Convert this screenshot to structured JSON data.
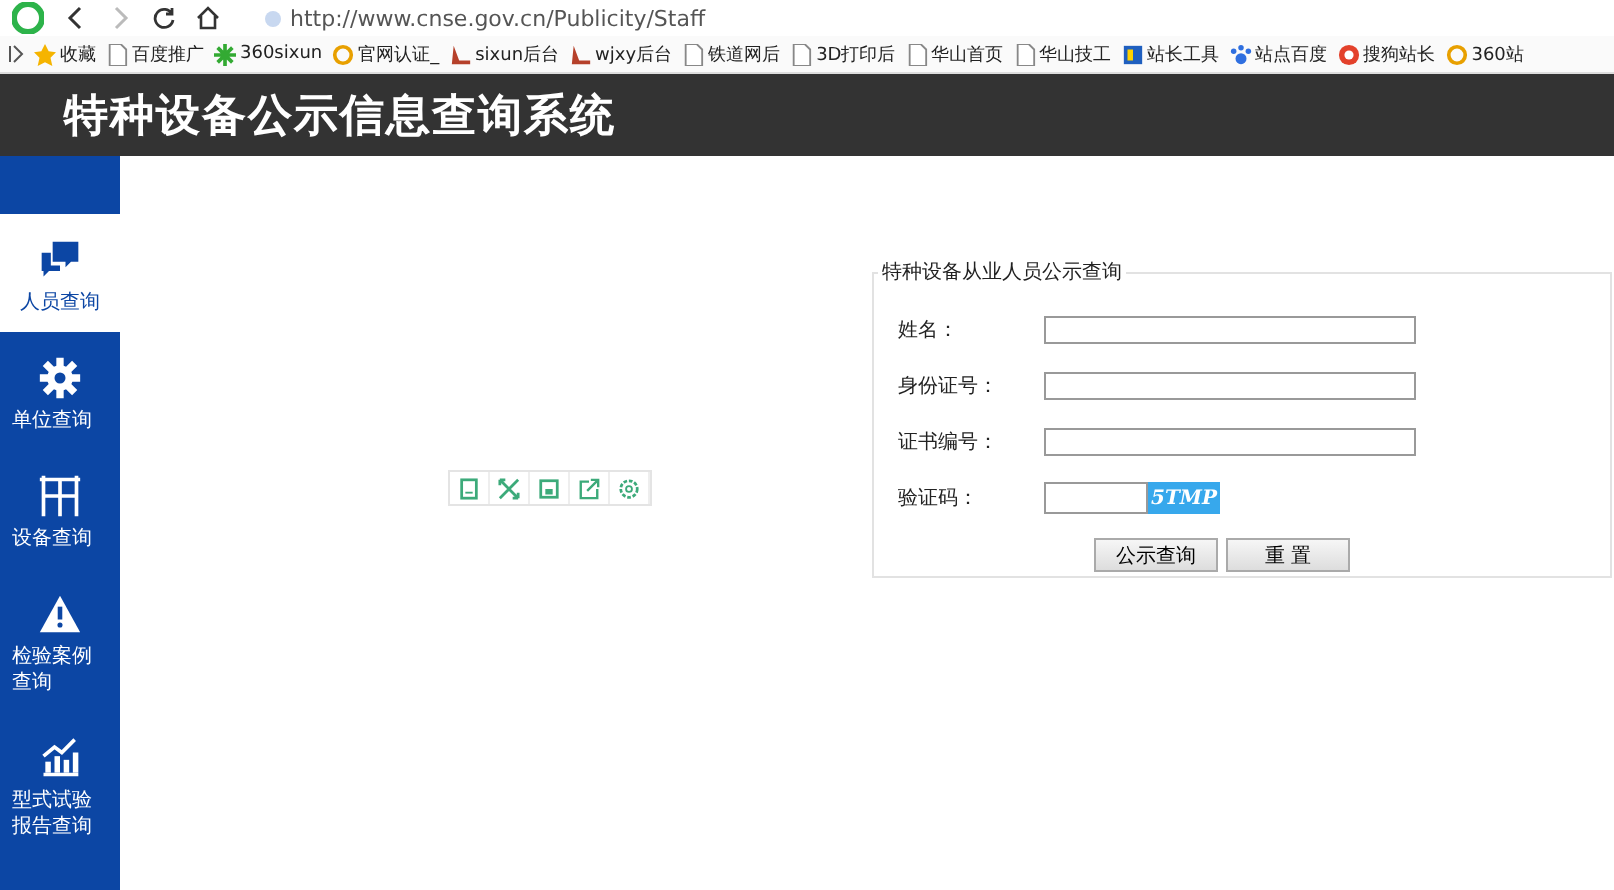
{
  "browser": {
    "url": "http://www.cnse.gov.cn/Publicity/Staff",
    "bookmarks": [
      {
        "label": "收藏",
        "kind": "star"
      },
      {
        "label": "百度推广",
        "kind": "page"
      },
      {
        "label": "360sixun",
        "kind": "leaf"
      },
      {
        "label": "官网认证_",
        "kind": "ring"
      },
      {
        "label": "sixun后台",
        "kind": "boot"
      },
      {
        "label": "wjxy后台",
        "kind": "boot"
      },
      {
        "label": "铁道网后",
        "kind": "page"
      },
      {
        "label": "3D打印后",
        "kind": "page"
      },
      {
        "label": "华山首页",
        "kind": "page"
      },
      {
        "label": "华山技工",
        "kind": "page"
      },
      {
        "label": "站长工具",
        "kind": "tool"
      },
      {
        "label": "站点百度",
        "kind": "paw"
      },
      {
        "label": "搜狗站长",
        "kind": "sogou"
      },
      {
        "label": "360站",
        "kind": "ring"
      }
    ]
  },
  "header": {
    "title": "特种设备公示信息查询系统"
  },
  "sidebar": {
    "items": [
      {
        "label": "人员查询",
        "selected": true
      },
      {
        "label": "单位查询",
        "selected": false
      },
      {
        "label": "设备查询",
        "selected": false
      },
      {
        "label": "检验案例查询",
        "selected": false
      },
      {
        "label": "型式试验报告查询",
        "selected": false
      }
    ]
  },
  "form": {
    "legend": "特种设备从业人员公示查询",
    "fields": [
      {
        "label": "姓名：",
        "kind": "text"
      },
      {
        "label": "身份证号：",
        "kind": "text"
      },
      {
        "label": "证书编号：",
        "kind": "text"
      },
      {
        "label": "验证码：",
        "kind": "captcha",
        "captcha": "5TMP"
      }
    ],
    "buttons": [
      "公示查询",
      "重 置"
    ]
  }
}
